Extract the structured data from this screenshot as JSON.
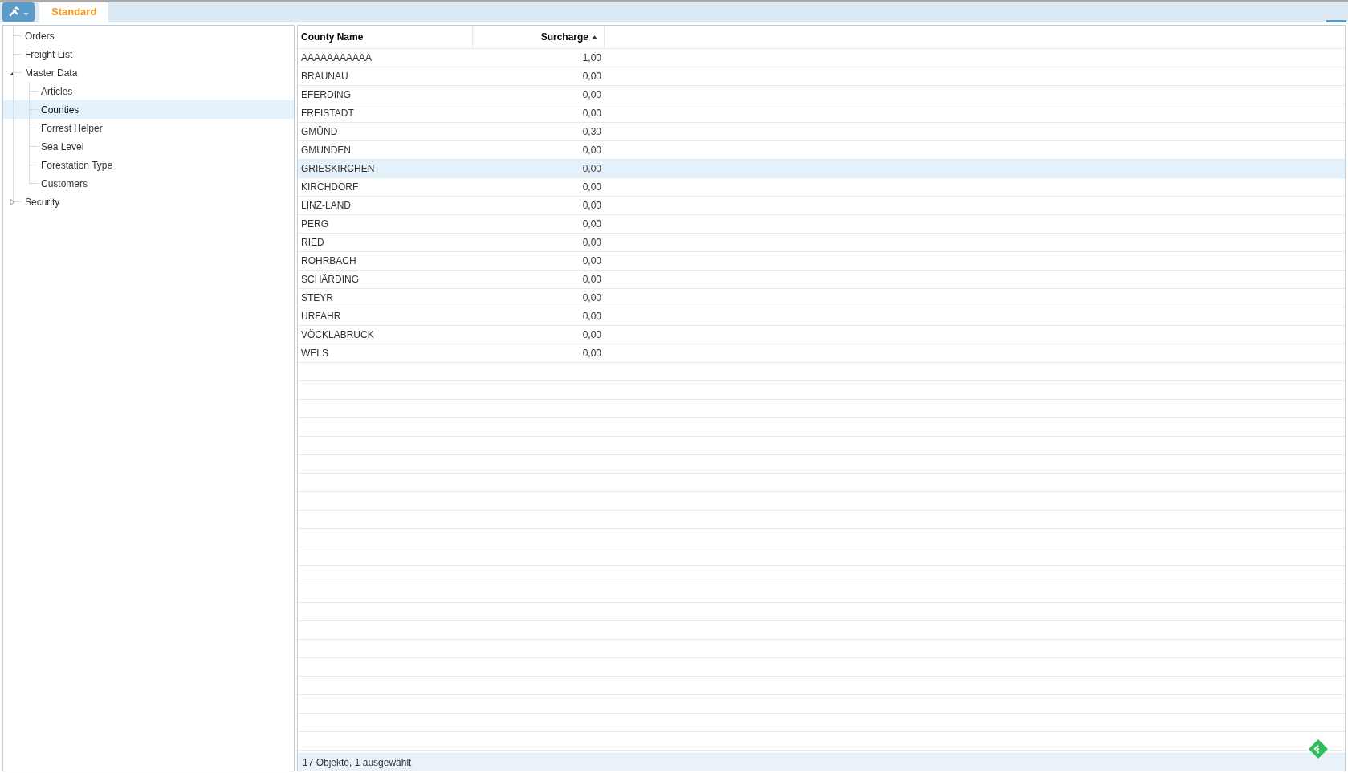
{
  "tabs": [
    {
      "label": "Standard",
      "selected": true
    }
  ],
  "tree": [
    {
      "label": "Orders"
    },
    {
      "label": "Freight List"
    },
    {
      "label": "Master Data",
      "expanded": true,
      "children": [
        {
          "label": "Articles",
          "selected": false
        },
        {
          "label": "Counties",
          "selected": true
        },
        {
          "label": "Forrest Helper",
          "selected": false
        },
        {
          "label": "Sea Level",
          "selected": false
        },
        {
          "label": "Forestation Type",
          "selected": false
        },
        {
          "label": "Customers",
          "selected": false
        }
      ]
    },
    {
      "label": "Security",
      "expanded": false
    }
  ],
  "table": {
    "columns": [
      {
        "label": "County Name",
        "sorted": false
      },
      {
        "label": "Surcharge",
        "sorted": true
      }
    ],
    "rows": [
      {
        "cells": [
          "AAAAAAAAAAA",
          "1,00"
        ],
        "selected": false
      },
      {
        "cells": [
          "BRAUNAU",
          "0,00"
        ],
        "selected": false
      },
      {
        "cells": [
          "EFERDING",
          "0,00"
        ],
        "selected": false
      },
      {
        "cells": [
          "FREISTADT",
          "0,00"
        ],
        "selected": false
      },
      {
        "cells": [
          "GMÜND",
          "0,30"
        ],
        "selected": false
      },
      {
        "cells": [
          "GMUNDEN",
          "0,00"
        ],
        "selected": false
      },
      {
        "cells": [
          "GRIESKIRCHEN",
          "0,00"
        ],
        "selected": true
      },
      {
        "cells": [
          "KIRCHDORF",
          "0,00"
        ],
        "selected": false
      },
      {
        "cells": [
          "LINZ-LAND",
          "0,00"
        ],
        "selected": false
      },
      {
        "cells": [
          "PERG",
          "0,00"
        ],
        "selected": false
      },
      {
        "cells": [
          "RIED",
          "0,00"
        ],
        "selected": false
      },
      {
        "cells": [
          "ROHRBACH",
          "0,00"
        ],
        "selected": false
      },
      {
        "cells": [
          "SCHÄRDING",
          "0,00"
        ],
        "selected": false
      },
      {
        "cells": [
          "STEYR",
          "0,00"
        ],
        "selected": false
      },
      {
        "cells": [
          "URFAHR",
          "0,00"
        ],
        "selected": false
      },
      {
        "cells": [
          "VÖCKLABRUCK",
          "0,00"
        ],
        "selected": false
      },
      {
        "cells": [
          "WELS",
          "0,00"
        ],
        "selected": false
      }
    ]
  },
  "status_bar": "17 Objekte, 1 ausgewählt"
}
